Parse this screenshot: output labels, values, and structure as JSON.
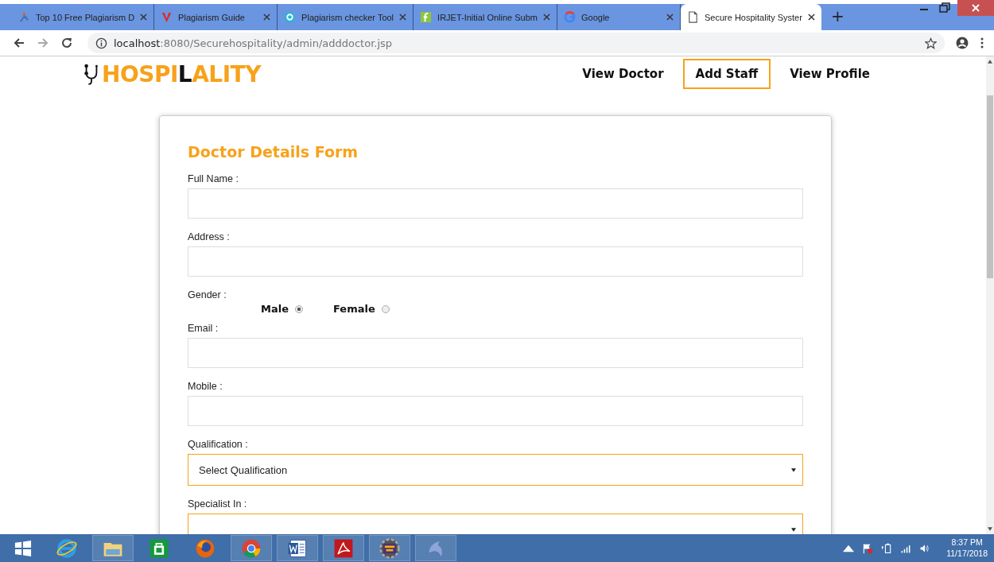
{
  "browser": {
    "tabs": [
      {
        "title": "Top 10 Free Plagiarism D",
        "selected": false
      },
      {
        "title": "Plagiarism Guide",
        "selected": false
      },
      {
        "title": "Plagiarism checker Tool",
        "selected": false
      },
      {
        "title": "IRJET-Initial Online Subm",
        "selected": false
      },
      {
        "title": "Google",
        "selected": false
      },
      {
        "title": "Secure Hospitality Syster",
        "selected": true
      }
    ],
    "new_tab": "+",
    "url_host": "localhost",
    "url_rest": ":8080/Securehospitality/admin/adddoctor.jsp"
  },
  "header": {
    "logo_parts": [
      {
        "text": "HOSPI",
        "color": "#f7a21b"
      },
      {
        "text": "L",
        "color": "#111111"
      },
      {
        "text": "ALITY",
        "color": "#f7a21b"
      }
    ],
    "nav": [
      {
        "label": "View Doctor",
        "selected": false
      },
      {
        "label": "Add Staff",
        "selected": true
      },
      {
        "label": "View Profile",
        "selected": false
      }
    ]
  },
  "form": {
    "title": "Doctor Details Form",
    "fields": [
      {
        "kind": "text",
        "label": "Full Name :"
      },
      {
        "kind": "text",
        "label": "Address :"
      },
      {
        "kind": "radio",
        "label": "Gender :",
        "options": [
          {
            "label": "Male",
            "selected": true
          },
          {
            "label": "Female",
            "selected": false
          }
        ]
      },
      {
        "kind": "text",
        "label": "Email :"
      },
      {
        "kind": "text",
        "label": "Mobile :"
      },
      {
        "kind": "select",
        "label": "Qualification :",
        "value": "Select Qualification"
      },
      {
        "kind": "select",
        "label": "Specialist In :"
      }
    ]
  },
  "taskbar": {
    "apps": [
      {
        "selected": false
      },
      {
        "selected": true
      },
      {
        "selected": false
      },
      {
        "selected": false
      },
      {
        "selected": true
      },
      {
        "selected": true
      },
      {
        "selected": true
      },
      {
        "selected": true
      },
      {
        "selected": true
      }
    ],
    "time": "8:37 PM",
    "date": "11/17/2018"
  }
}
